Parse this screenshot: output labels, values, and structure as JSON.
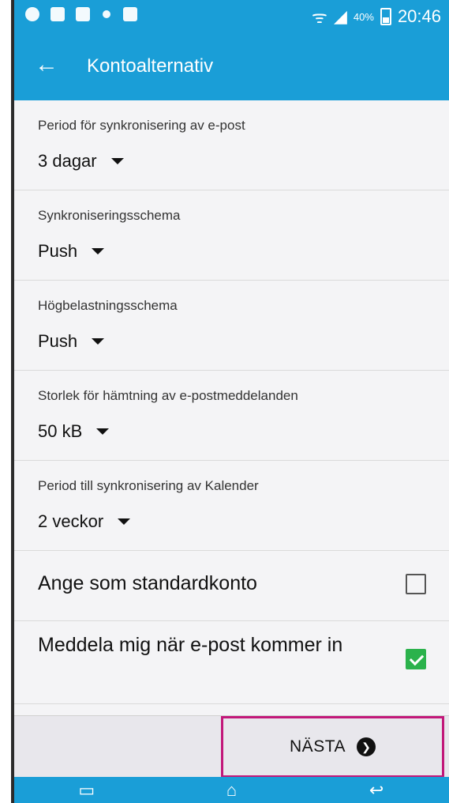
{
  "status": {
    "battery_percent": "40%",
    "time": "20:46"
  },
  "appbar": {
    "back_label": "←",
    "title": "Kontoalternativ"
  },
  "settings": [
    {
      "label": "Period för synkronisering av e-post",
      "value": "3 dagar"
    },
    {
      "label": "Synkroniseringsschema",
      "value": "Push"
    },
    {
      "label": "Högbelastningsschema",
      "value": "Push"
    },
    {
      "label": "Storlek för hämtning av e-postmeddelanden",
      "value": "50 kB"
    },
    {
      "label": "Period till synkronisering av Kalender",
      "value": "2 veckor"
    }
  ],
  "toggles": [
    {
      "label": "Ange som standardkonto",
      "checked": false
    },
    {
      "label": "Meddela mig när e-post kommer in",
      "checked": true
    }
  ],
  "bottom": {
    "next_label": "NÄSTA",
    "next_icon": "❯"
  },
  "navbar": {
    "recent_icon": "▭",
    "home_icon": "⌂",
    "back_icon": "↩"
  },
  "colors": {
    "accent": "#1a9ed7",
    "highlight": "#c2187a",
    "check": "#2bb24c"
  }
}
